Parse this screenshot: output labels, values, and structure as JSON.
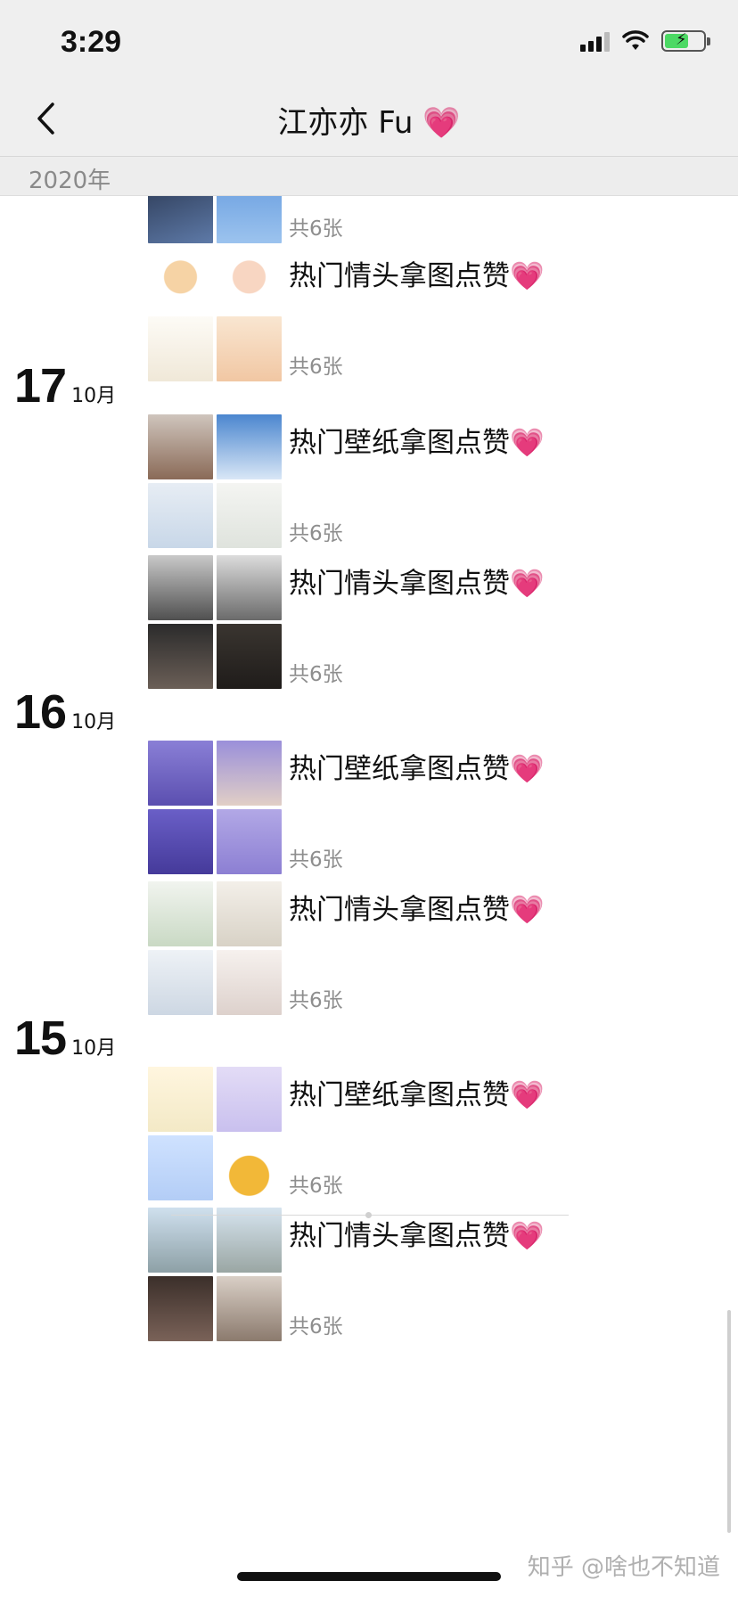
{
  "status_bar": {
    "time": "3:29",
    "battery_color": "#4cd964"
  },
  "nav": {
    "back_icon": "chevron-left-icon",
    "title": "江亦亦 Fu",
    "title_emoji": "💗"
  },
  "year_header": "2020年",
  "posts_common": {
    "emoji": "💗",
    "count": "共6张"
  },
  "dates": [
    {
      "day": "17",
      "month": "10月"
    },
    {
      "day": "16",
      "month": "10月"
    },
    {
      "day": "15",
      "month": "10月"
    }
  ],
  "posts": [
    {
      "title": "热门情头拿图点赞",
      "count": "共6张"
    },
    {
      "title": "热门壁纸拿图点赞",
      "count": "共6张"
    },
    {
      "title": "热门情头拿图点赞",
      "count": "共6张"
    },
    {
      "title": "热门壁纸拿图点赞",
      "count": "共6张"
    },
    {
      "title": "热门情头拿图点赞",
      "count": "共6张"
    },
    {
      "title": "热门壁纸拿图点赞",
      "count": "共6张"
    },
    {
      "title": "热门情头拿图点赞",
      "count": "共6张"
    }
  ],
  "top_partial_post": {
    "count": "共6张"
  },
  "watermark": "知乎 @啥也不知道"
}
